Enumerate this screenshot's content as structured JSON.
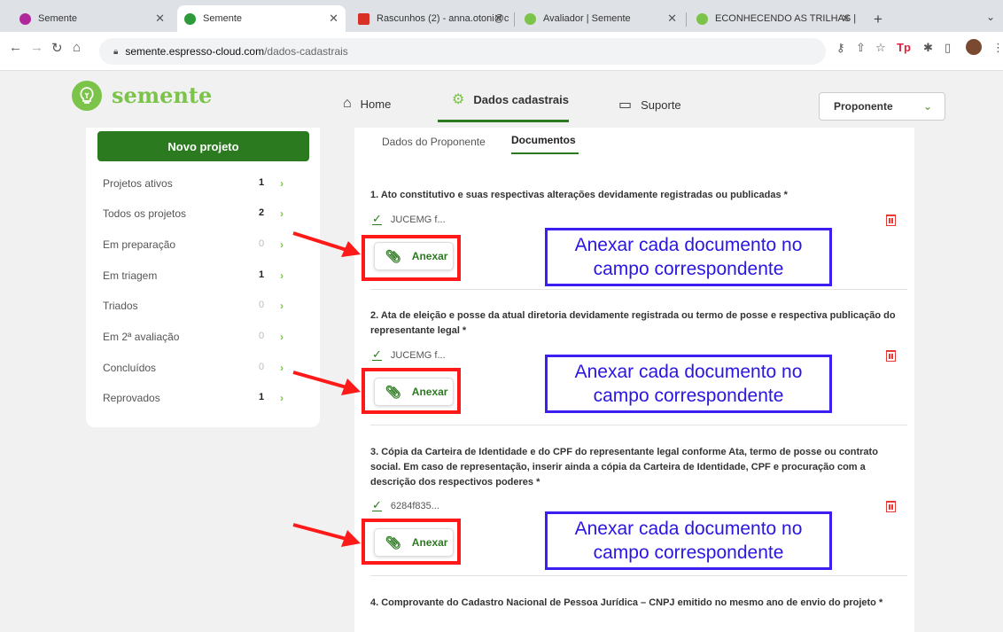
{
  "tabs": [
    {
      "title": "Semente",
      "favicon_color": "#b0279c"
    },
    {
      "title": "Semente",
      "favicon_color": "#2e9a3a"
    },
    {
      "title": "Rascunhos (2) - anna.otoni@c",
      "favicon_color": "#d93025"
    },
    {
      "title": "Avaliador | Semente",
      "favicon_color": "#7cc34a"
    },
    {
      "title": "ECONHECENDO AS TRILHAS |",
      "favicon_color": "#7cc34a"
    }
  ],
  "address": {
    "host": "semente.espresso-cloud.com",
    "path": "/dados-cadastrais"
  },
  "brand": {
    "name": "semente",
    "color": "#7cc34a"
  },
  "nav": {
    "home": "Home",
    "dados": "Dados cadastrais",
    "suporte": "Suporte"
  },
  "role_select": {
    "value": "Proponente"
  },
  "sidebar": {
    "new_project": "Novo projeto",
    "items": [
      {
        "label": "Projetos ativos",
        "count": "1"
      },
      {
        "label": "Todos os projetos",
        "count": "2"
      },
      {
        "label": "Em preparação",
        "count": "0"
      },
      {
        "label": "Em triagem",
        "count": "1"
      },
      {
        "label": "Triados",
        "count": "0"
      },
      {
        "label": "Em 2ª avaliação",
        "count": "0"
      },
      {
        "label": "Concluídos",
        "count": "0"
      },
      {
        "label": "Reprovados",
        "count": "1"
      }
    ]
  },
  "subtabs": {
    "proponente": "Dados do Proponente",
    "documentos": "Documentos"
  },
  "documents": [
    {
      "title": "1. Ato constitutivo e suas respectivas alterações devidamente registradas ou publicadas *",
      "file": "JUCEMG f...",
      "attach": "Anexar"
    },
    {
      "title": "2. Ata de eleição e posse da atual diretoria devidamente registrada ou termo de posse e respectiva publicação do representante legal *",
      "file": "JUCEMG f...",
      "attach": "Anexar"
    },
    {
      "title": "3. Cópia da Carteira de Identidade e do CPF do representante legal conforme Ata, termo de posse ou contrato social. Em caso de representação, inserir ainda a cópia da Carteira de Identidade, CPF e procuração com a descrição dos respectivos poderes *",
      "file": "6284f835...",
      "attach": "Anexar"
    },
    {
      "title": "4. Comprovante do Cadastro Nacional de Pessoa Jurídica – CNPJ emitido no mesmo ano de envio do projeto *"
    }
  ],
  "annotation": {
    "note": "Anexar cada documento no campo correspondente",
    "note_color": "#2a16e0",
    "highlight_color": "#ff1a1a"
  },
  "colors": {
    "primary": "#2b7a1f",
    "accent": "#7cc34a",
    "danger": "#e53935"
  }
}
